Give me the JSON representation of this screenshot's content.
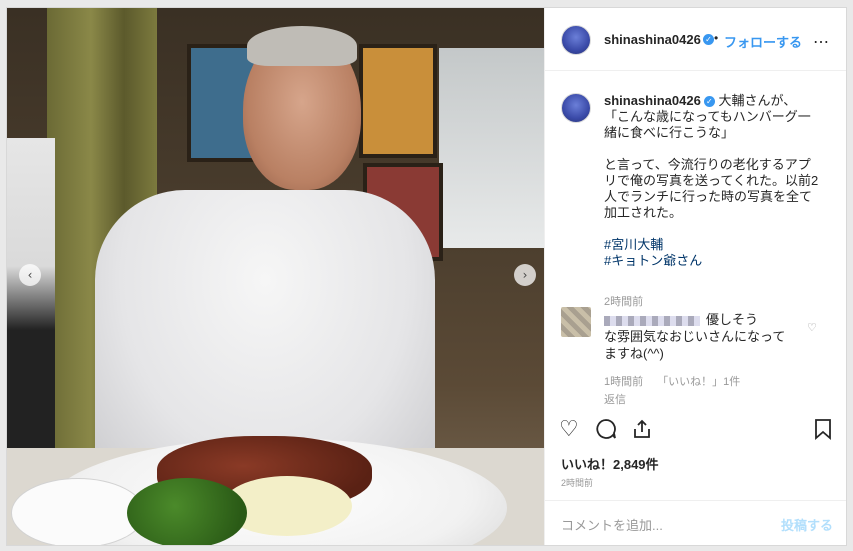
{
  "header": {
    "username": "shinashina0426",
    "verified_icon": "verified-badge-icon",
    "separator": "•",
    "follow_label": "フォローする",
    "more_label": "…"
  },
  "caption": {
    "username": "shinashina0426",
    "lines": [
      "大輔さんが、",
      "「こんな歳になってもハンバーグ一",
      "緒に食べに行こうな」",
      "",
      "と言って、今流行りの老化するアプ",
      "リで俺の写真を送ってくれた。以前2",
      "人でランチに行った時の写真を全て",
      "加工された。"
    ],
    "hashtags": [
      "#宮川大輔",
      "#キョトン爺さん"
    ],
    "time": "2時間前"
  },
  "comment": {
    "text_line1": "優しそう",
    "text_line2": "な雰囲気なおじいさんになって",
    "text_line3": "ますね(^^)",
    "time": "1時間前",
    "likes": "「いいね！」1件",
    "reply_label": "返信"
  },
  "actions": {
    "like_icon": "heart-icon",
    "comment_icon": "comment-icon",
    "share_icon": "share-icon",
    "save_icon": "bookmark-icon"
  },
  "likes_text": "いいね！2,849件",
  "post_time": "2時間前",
  "add_comment": {
    "placeholder": "コメントを追加...",
    "post_label": "投稿する"
  },
  "nav": {
    "prev": "‹",
    "next": "›"
  }
}
